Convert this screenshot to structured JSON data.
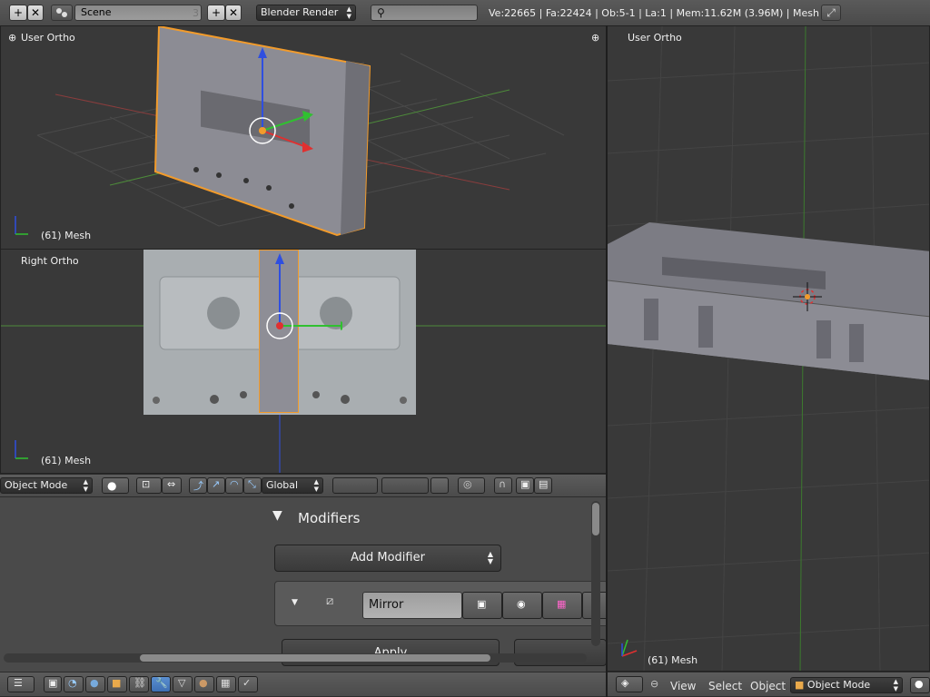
{
  "topbar": {
    "scene_label": "Scene",
    "scene_users": "3",
    "render_engine": "Blender Render",
    "search_placeholder": "",
    "stats": "Ve:22665 | Fa:22424 | Ob:5-1 | La:1 | Mem:11.62M (3.96M) | Mesh"
  },
  "viewport_top_left": {
    "view_name": "User Ortho",
    "object_info": "(61) Mesh"
  },
  "viewport_bottom_left": {
    "view_name": "Right Ortho",
    "object_info": "(61) Mesh"
  },
  "viewport_right": {
    "view_name": "User Ortho",
    "object_info": "(61) Mesh"
  },
  "view3d_header": {
    "mode": "Object Mode",
    "orientation": "Global"
  },
  "properties": {
    "panel_title": "Modifiers",
    "add_modifier": "Add Modifier",
    "modifier_name": "Mirror",
    "apply_label": "Apply"
  },
  "right_header": {
    "view_menu": "View",
    "select_menu": "Select",
    "object_menu": "Object",
    "mode": "Object Mode"
  },
  "colors": {
    "selection": "#f29b2b",
    "axis_x": "#e03030",
    "axis_y": "#30c030",
    "axis_z": "#2f4fe0"
  },
  "icons": [
    "add-icon",
    "close-icon",
    "scene-icon",
    "search-icon",
    "fullscreen-icon",
    "render-icon",
    "world-icon",
    "object-icon",
    "constraint-icon",
    "modifier-icon",
    "mesh-data-icon",
    "material-icon",
    "texture-icon",
    "particles-icon",
    "physics-icon"
  ]
}
